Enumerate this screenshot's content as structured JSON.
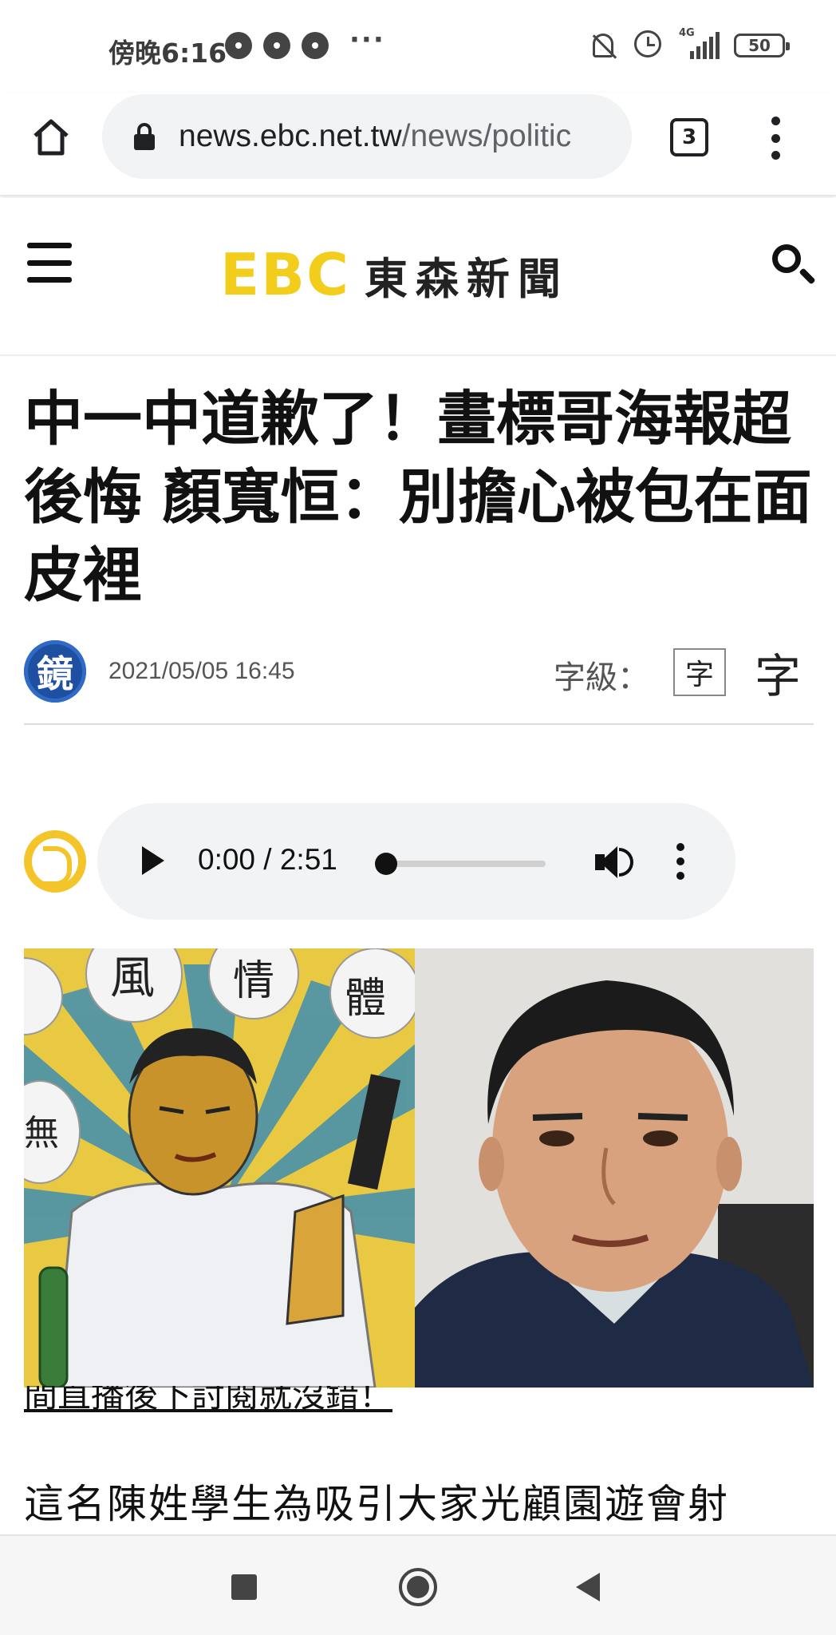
{
  "status": {
    "time": "傍晚6:16",
    "more": "···",
    "network": "4G",
    "battery": "50"
  },
  "browser": {
    "url_host": "news.ebc.net.tw",
    "url_path": "/news/politic",
    "tab_count": "3"
  },
  "site": {
    "logo_text": "EBC",
    "logo_cn": "東森新聞",
    "brand_color": "#f2cd1c"
  },
  "article": {
    "title": "中一中道歉了！畫標哥海報超後悔 顏寬恒：別擔心被包在面皮裡",
    "source_logo": "鏡",
    "date": "2021/05/05 16:45",
    "font_size_label": "字級：",
    "font_small": "字",
    "font_large": "字",
    "partial_link": "間直播後下討閱就沒錯！",
    "body_first_line": "這名陳姓學生為吸引大家光顧園遊會射"
  },
  "audio": {
    "time": "0:00 / 2:51",
    "progress": 0
  },
  "photo": {
    "poster_chars": [
      "風",
      "情",
      "體",
      "無"
    ]
  }
}
